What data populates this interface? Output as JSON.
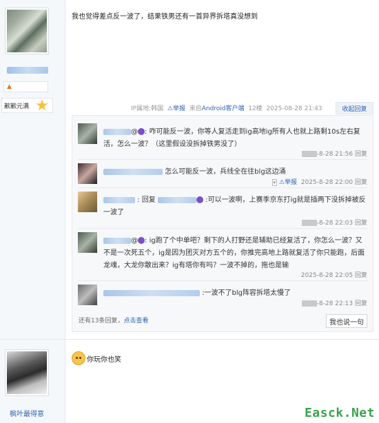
{
  "post": {
    "text": "我也觉得差点反一波了，结果铁男还有一首异界拆塔真没想到",
    "level_name": "歉歉元满",
    "ip_label": "IP属地:韩国",
    "report": "举报",
    "source": "来自Android客户端",
    "floor": "12楼",
    "time": "2025-08-28 21:43",
    "collapse": "收起回复"
  },
  "replies": [
    {
      "text_before": ":",
      "text": "咋可能反一波，你等人复活走到ig高地ig所有人也就上路剩10s左右复活，怎么一波？（这里假设没拆掉铁男没了）",
      "date": "-8-28 21:56",
      "reply": "回复"
    },
    {
      "text": "怎么可能反一波，兵线全在往blg这边涌",
      "report": "举报",
      "date": "2025-8-28 22:00",
      "reply": "回复"
    },
    {
      "prefix": ": 回复",
      "text": ":可以一波啊，上赛季京东打ig就是插两下没拆掉被反一波了",
      "date": "-8-28 22:03",
      "reply": "回复"
    },
    {
      "text": "ig跑了个中单吧？剩下的人打野还是辅助已经复活了，你怎么一波？又不是一次死五个，ig是因为团灭对方五个的，你推完高地上路就复活了你只能跑，后面龙魂，大龙你散出来？ig有塔你有吗？一波不掉的，拖也是输",
      "date": "2025-8-28 22:05",
      "reply": "回复"
    },
    {
      "text": ":一波不了blg阵容拆塔太慢了",
      "date": "-8-28 22:13",
      "reply": "回复"
    }
  ],
  "more": {
    "prefix": "还有13条回复，",
    "link": "点击查看"
  },
  "say_button": "我也说一句",
  "post2": {
    "text": "你玩你也笑"
  },
  "bottom_user": "枫叶最得意",
  "watermark": "Easck.Net"
}
